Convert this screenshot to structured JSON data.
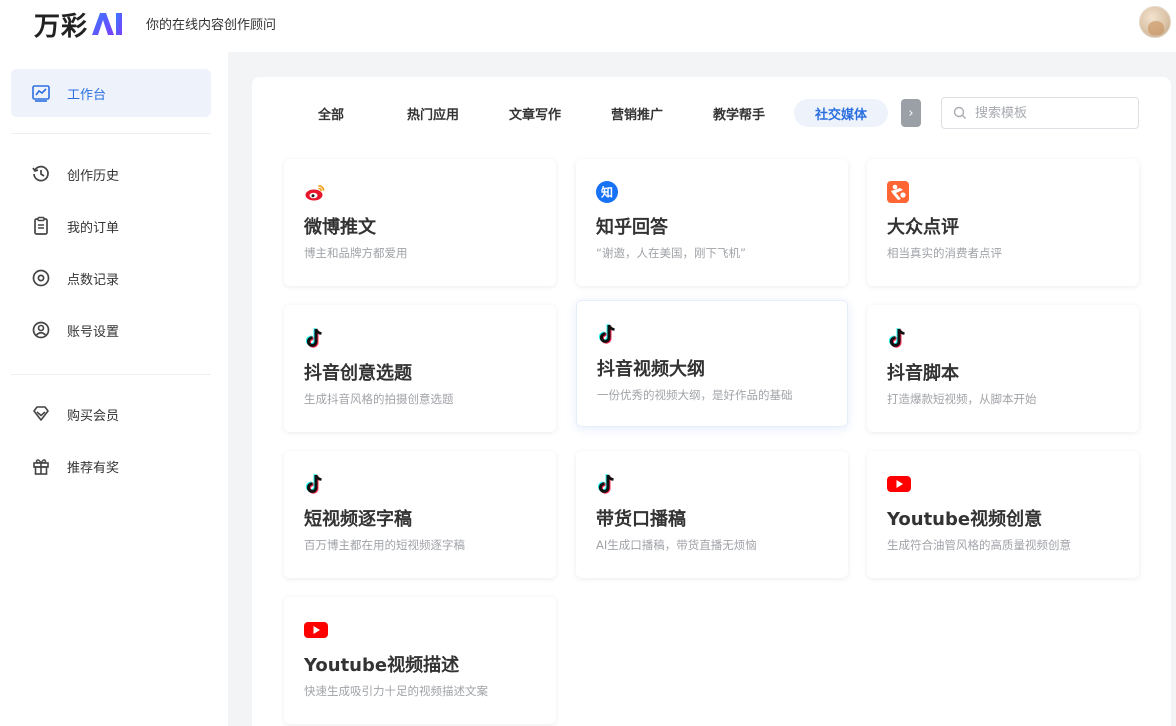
{
  "header": {
    "logo_text": "万彩",
    "logo_ai": "AI",
    "tagline": "你的在线内容创作顾问"
  },
  "sidebar": {
    "items": [
      {
        "label": "工作台",
        "icon": "chart-icon",
        "active": true
      },
      {
        "label": "创作历史",
        "icon": "history-icon"
      },
      {
        "label": "我的订单",
        "icon": "clipboard-icon"
      },
      {
        "label": "点数记录",
        "icon": "points-icon"
      },
      {
        "label": "账号设置",
        "icon": "user-circle-icon"
      },
      {
        "label": "购买会员",
        "icon": "diamond-icon"
      },
      {
        "label": "推荐有奖",
        "icon": "gift-icon"
      }
    ]
  },
  "tabs": [
    {
      "label": "全部"
    },
    {
      "label": "热门应用"
    },
    {
      "label": "文章写作"
    },
    {
      "label": "营销推广"
    },
    {
      "label": "教学帮手"
    },
    {
      "label": "社交媒体",
      "active": true
    }
  ],
  "search": {
    "placeholder": "搜索模板"
  },
  "cards": [
    {
      "title": "微博推文",
      "desc": "博主和品牌方都爱用",
      "icon": "weibo-icon"
    },
    {
      "title": "知乎回答",
      "desc": "“谢邀，人在美国，刚下飞机”",
      "icon": "zhihu-icon"
    },
    {
      "title": "大众点评",
      "desc": "相当真实的消费者点评",
      "icon": "dianping-icon"
    },
    {
      "title": "抖音创意选题",
      "desc": "生成抖音风格的拍摄创意选题",
      "icon": "tiktok-icon"
    },
    {
      "title": "抖音视频大纲",
      "desc": "一份优秀的视频大纲，是好作品的基础",
      "icon": "tiktok-icon"
    },
    {
      "title": "抖音脚本",
      "desc": "打造爆款短视频，从脚本开始",
      "icon": "tiktok-icon"
    },
    {
      "title": "短视频逐字稿",
      "desc": "百万博主都在用的短视频逐字稿",
      "icon": "tiktok-icon"
    },
    {
      "title": "带货口播稿",
      "desc": "AI生成口播稿，带货直播无烦恼",
      "icon": "tiktok-icon"
    },
    {
      "title": "Youtube视频创意",
      "desc": "生成符合油管风格的高质量视频创意",
      "icon": "youtube-icon"
    },
    {
      "title": "Youtube视频描述",
      "desc": "快速生成吸引力十足的视频描述文案",
      "icon": "youtube-icon"
    }
  ],
  "colors": {
    "accent": "#2b6fe0",
    "youtube": "#ff0000",
    "weibo": "#e6162d",
    "zhihu": "#1772f6",
    "dianping": "#ff6633"
  }
}
